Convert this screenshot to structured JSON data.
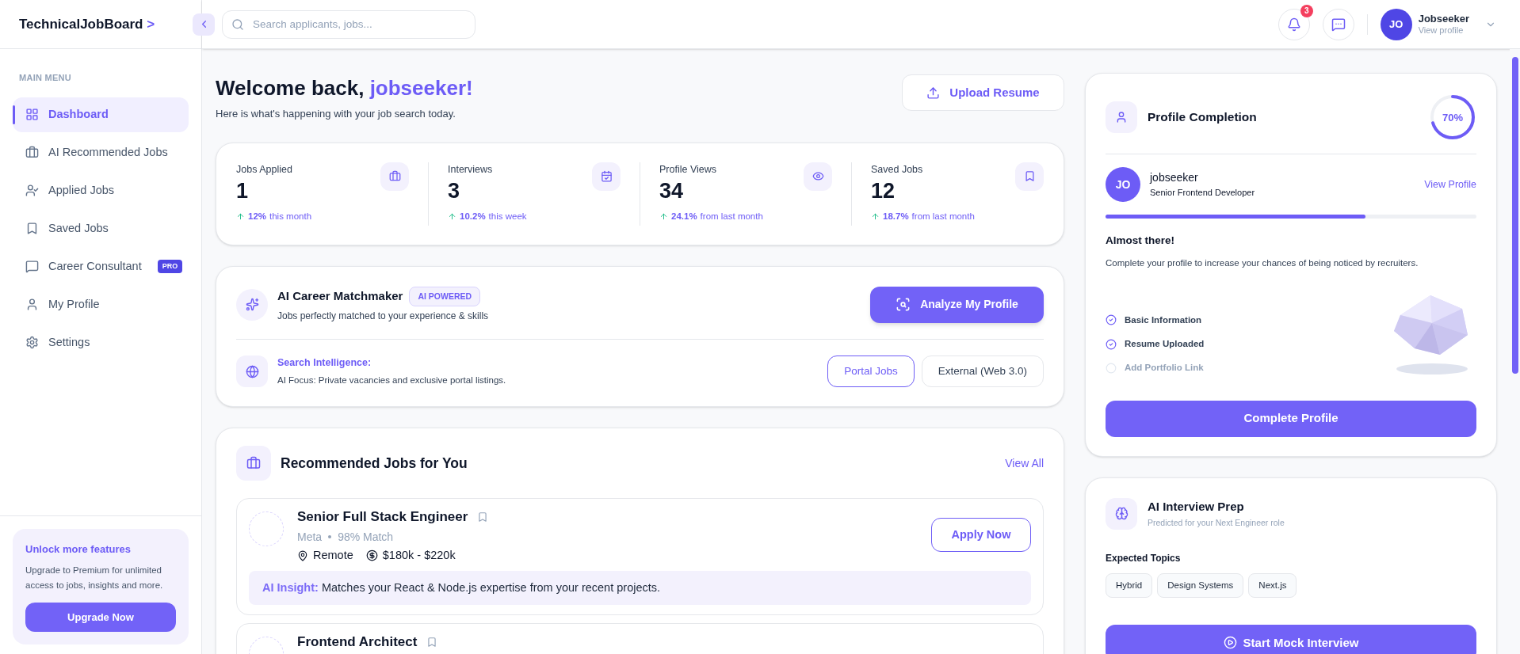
{
  "brand": {
    "name": "TechnicalJobBoard",
    "mark": ">"
  },
  "sidebar": {
    "section_title": "MAIN MENU",
    "items": [
      {
        "label": "Dashboard",
        "selected": true
      },
      {
        "label": "AI Recommended Jobs",
        "selected": false
      },
      {
        "label": "Applied Jobs",
        "selected": false
      },
      {
        "label": "Saved Jobs",
        "selected": false
      },
      {
        "label": "Career Consultant",
        "selected": false,
        "badge": "PRO"
      },
      {
        "label": "My Profile",
        "selected": false
      },
      {
        "label": "Settings",
        "selected": false
      }
    ],
    "promo": {
      "title": "Unlock more features",
      "text": "Upgrade to Premium for unlimited access to jobs, insights and more.",
      "button": "Upgrade Now"
    }
  },
  "search": {
    "placeholder": "Search applicants, jobs..."
  },
  "header": {
    "notification_count": "3",
    "user": {
      "initials": "JO",
      "name": "Jobseeker",
      "subtitle": "View profile"
    }
  },
  "welcome": {
    "greeting": "Welcome back,",
    "name": "jobseeker!",
    "subtitle": "Here is what's happening with your job search today.",
    "upload_button": "Upload Resume"
  },
  "stats": [
    {
      "label": "Jobs Applied",
      "value": "1",
      "change": "12%",
      "period": "this month"
    },
    {
      "label": "Interviews",
      "value": "3",
      "change": "10.2%",
      "period": "this week"
    },
    {
      "label": "Profile Views",
      "value": "34",
      "change": "24.1%",
      "period": "from last month"
    },
    {
      "label": "Saved Jobs",
      "value": "12",
      "change": "18.7%",
      "period": "from last month"
    }
  ],
  "matchmaker": {
    "title": "AI Career Matchmaker",
    "badge": "AI POWERED",
    "subtitle": "Jobs perfectly matched to your experience & skills",
    "button": "Analyze My Profile",
    "intelligence_title": "Search Intelligence:",
    "intelligence_text": "AI Focus: Private vacancies and exclusive portal listings.",
    "sources": [
      {
        "label": "Portal Jobs",
        "selected": true
      },
      {
        "label": "External (Web 3.0)",
        "selected": false
      }
    ]
  },
  "recommended": {
    "title": "Recommended Jobs for You",
    "view_all": "View All",
    "jobs": [
      {
        "title": "Senior Full Stack Engineer",
        "company": "Meta",
        "match": "98% Match",
        "location": "Remote",
        "salary": "$180k - $220k",
        "insight_label": "AI Insight:",
        "insight_text": "Matches your React & Node.js expertise from your recent projects.",
        "button": "Apply Now"
      },
      {
        "title": "Frontend Architect"
      }
    ]
  },
  "profile_completion": {
    "title": "Profile Completion",
    "percent": "70%",
    "level": 0.7,
    "user": {
      "initials": "JO",
      "name": "jobseeker",
      "role": "Senior Frontend Developer"
    },
    "view_profile": "View Profile",
    "heading": "Almost there!",
    "text": "Complete your profile to increase your chances of being noticed by recruiters.",
    "checklist": [
      {
        "label": "Basic Information",
        "checked": true
      },
      {
        "label": "Resume Uploaded",
        "checked": true
      },
      {
        "label": "Add Portfolio Link",
        "checked": false
      }
    ],
    "button": "Complete Profile"
  },
  "interview_prep": {
    "title": "AI Interview Prep",
    "subtitle": "Predicted for your Next Engineer role",
    "topics_title": "Expected Topics",
    "topics": [
      "Hybrid",
      "Design Systems",
      "Next.js"
    ],
    "button": "Start Mock Interview"
  }
}
